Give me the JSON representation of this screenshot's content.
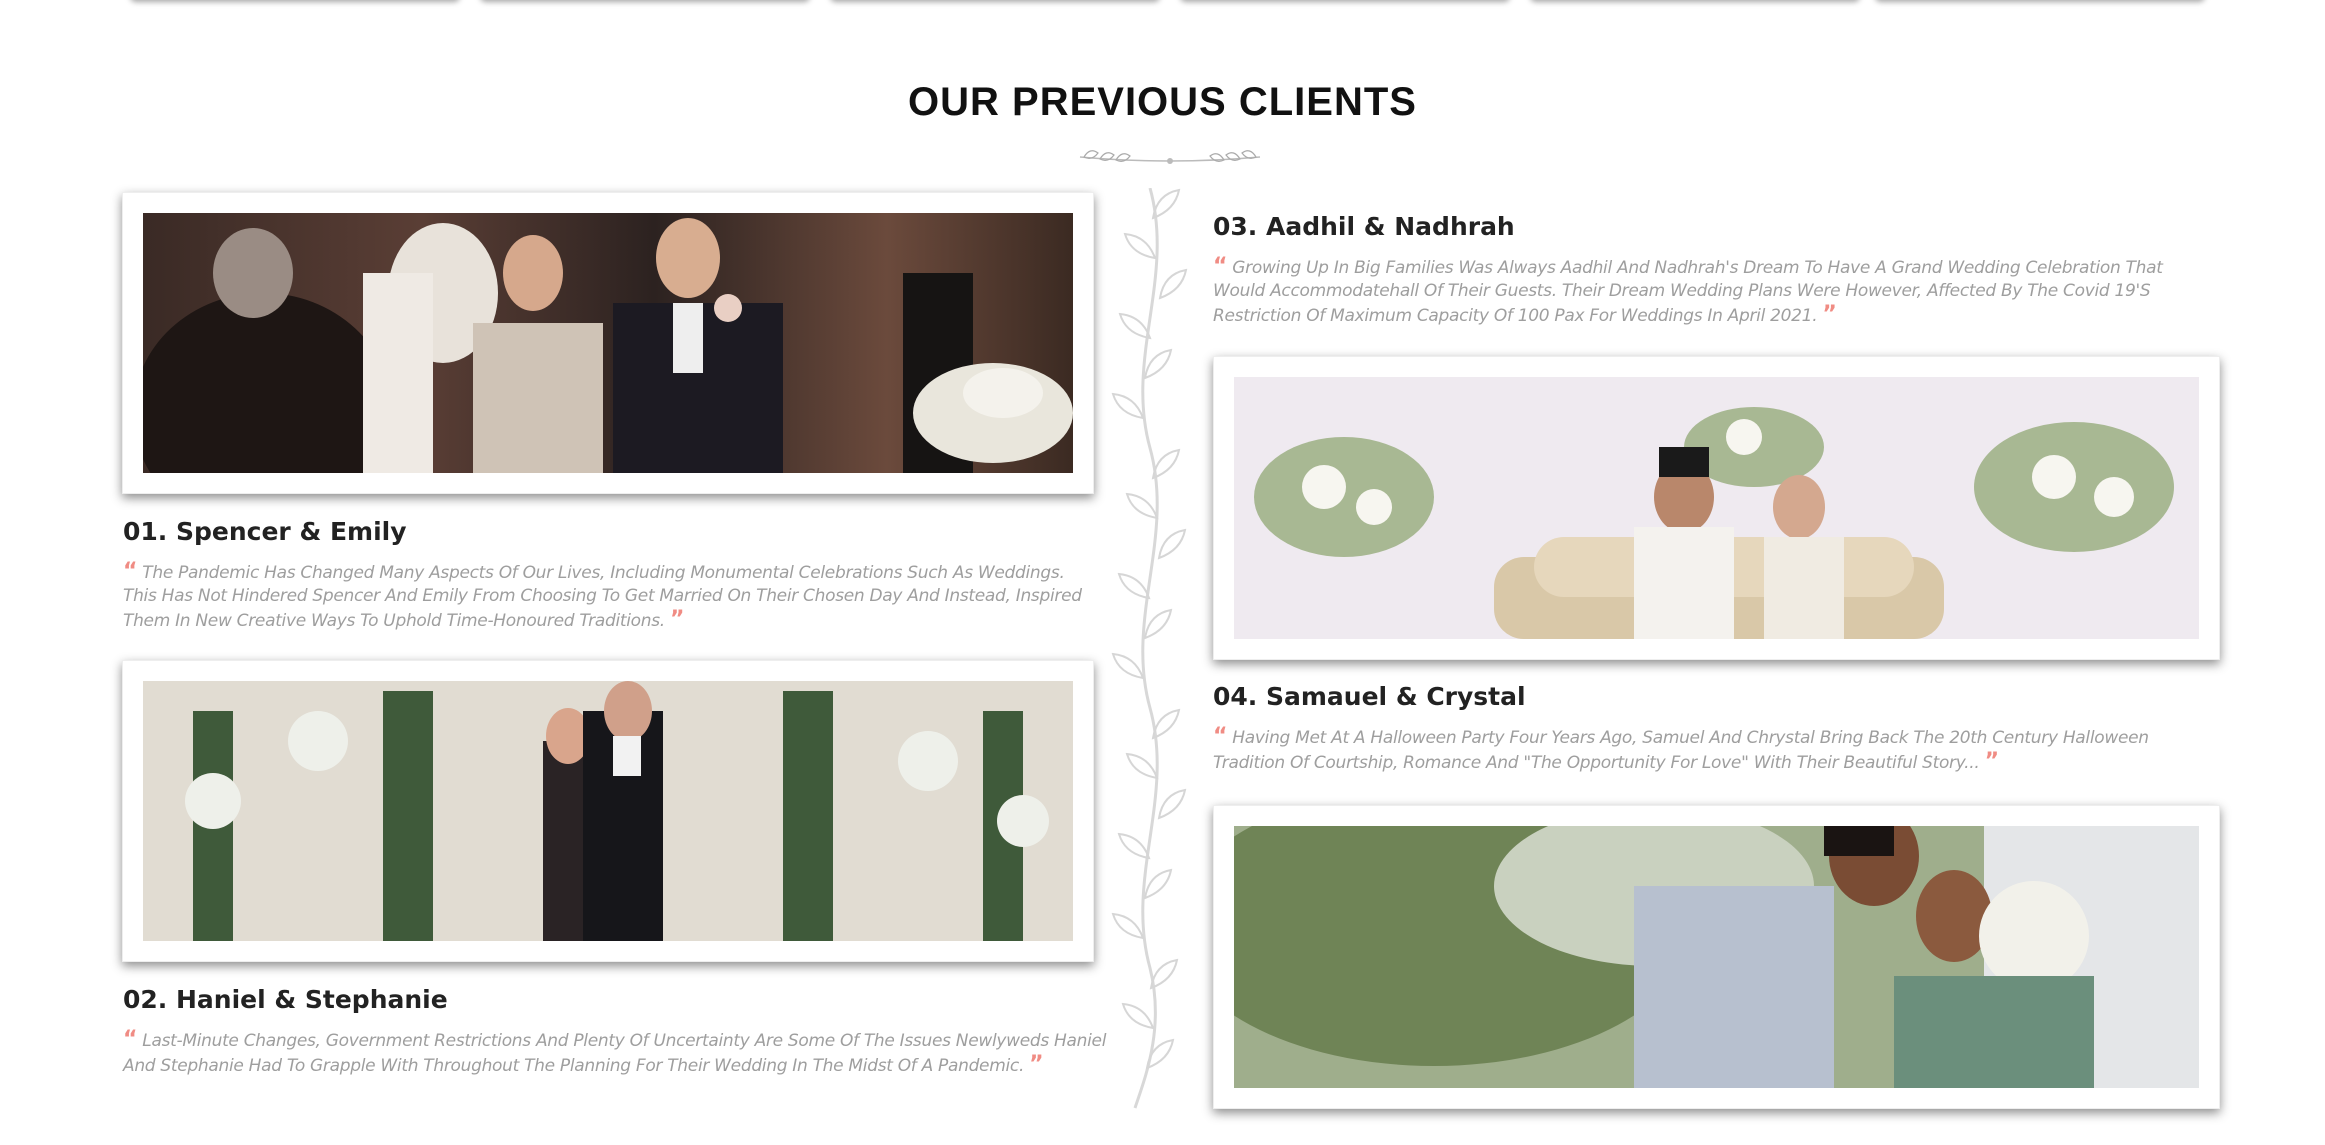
{
  "section": {
    "title": "OUR PREVIOUS CLIENTS"
  },
  "colors": {
    "accent_quote": "#f08c84",
    "title": "#111111",
    "body_text": "#9e9e9e"
  },
  "icons": {
    "ornament": "leaf-divider-icon",
    "vine": "vine-decoration-icon",
    "open_quote": "open-quote-icon",
    "close_quote": "close-quote-icon"
  },
  "clients": [
    {
      "name": "01. Spencer & Emily",
      "quote": "The Pandemic Has Changed Many Aspects Of Our Lives, Including Monumental Celebrations Such As Weddings. This Has Not Hindered Spencer And Emily From Choosing To Get Married On Their Chosen Day And Instead, Inspired Them In New Creative Ways To Uphold Time-Honoured Traditions."
    },
    {
      "name": "02. Haniel & Stephanie",
      "quote": "Last-Minute Changes, Government Restrictions And Plenty Of Uncertainty Are Some Of The Issues Newlyweds Haniel And Stephanie Had To Grapple With Throughout The Planning For Their Wedding In The Midst Of A Pandemic."
    },
    {
      "name": "03. Aadhil & Nadhrah",
      "quote": "Growing Up In Big Families Was Always Aadhil And Nadhrah's Dream To Have A Grand Wedding Celebration That Would Accommodatehall Of Their Guests. Their Dream Wedding Plans Were However, Affected By The Covid 19'S Restriction Of Maximum Capacity Of 100 Pax For Weddings In April 2021."
    },
    {
      "name": "04. Samauel & Crystal",
      "quote": "Having Met At A Halloween Party Four Years Ago, Samuel And Chrystal Bring Back The 20th Century Halloween Tradition Of Courtship, Romance And \"The Opportunity For Love\" With Their Beautiful Story..."
    }
  ],
  "quote_marks": {
    "open": "“",
    "close": "”"
  }
}
